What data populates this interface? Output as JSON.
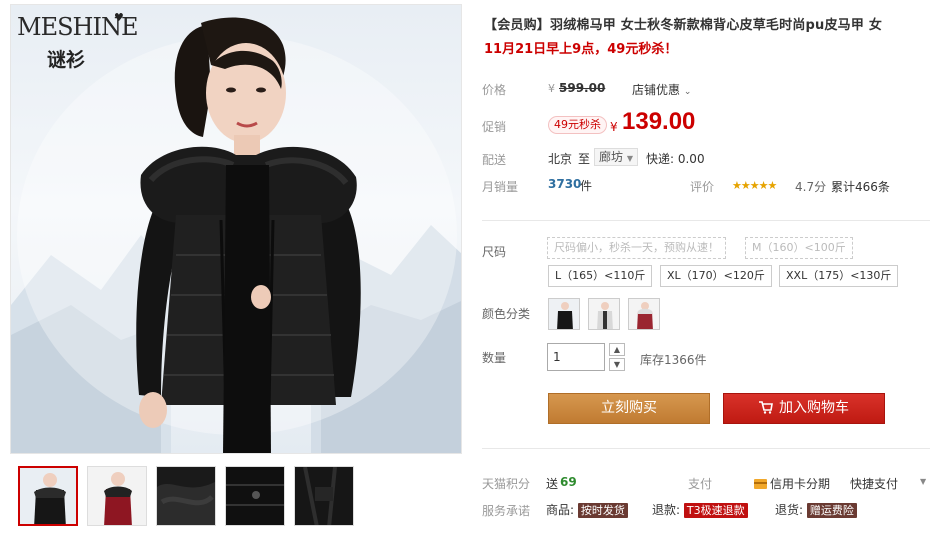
{
  "brand": {
    "name": "MESHINE",
    "name_cn": "谜衫"
  },
  "product": {
    "title": "【会员购】羽绒棉马甲 女士秋冬新款棉背心皮草毛时尚pu皮马甲 女",
    "subtitle": "11月21日早上9点，49元秒杀！"
  },
  "pricing": {
    "price_label": "价格",
    "original_currency": "¥",
    "original_price": "599.00",
    "store_discount": "店铺优惠",
    "promo_label": "促销",
    "promo_tag": "49元秒杀",
    "promo_currency": "¥",
    "promo_price": "139.00",
    "shipping_label": "配送",
    "ship_from": "北京",
    "ship_to_word": "至",
    "ship_dest": "廊坊",
    "express": "快递: 0.00",
    "sales_label": "月销量",
    "sales_count": "3730",
    "sales_unit": "件",
    "rating_label": "评价",
    "rating_stars": 5,
    "rating_score": "4.7分",
    "review_count": "累计466条"
  },
  "options": {
    "size_label": "尺码",
    "sizes": [
      {
        "label": "尺码偏小，秒杀一天，预购从速！",
        "disabled": true
      },
      {
        "label": "M（160）<100斤",
        "disabled": true
      },
      {
        "label": "L（165）<110斤",
        "disabled": false
      },
      {
        "label": "XL（170）<120斤",
        "disabled": false
      },
      {
        "label": "XXL（175）<130斤",
        "disabled": false
      }
    ],
    "color_label": "颜色分类",
    "quantity_label": "数量",
    "quantity_value": "1",
    "stock": "库存1366件"
  },
  "actions": {
    "buy_now": "立刻购买",
    "add_to_cart": "加入购物车"
  },
  "services": {
    "points_label": "天猫积分",
    "points_prefix": "送",
    "points_value": "69",
    "pay_label": "支付",
    "credit_card": "信用卡分期",
    "quick_pay": "快捷支付",
    "promise_label": "服务承诺",
    "promise_goods": "商品:",
    "tag_on_time": "按时发货",
    "promise_refund": "退款:",
    "tag_fast_refund": "T3极速退款",
    "promise_return": "退货:",
    "tag_return_insurance": "赠运费险"
  },
  "colors": {
    "accent_red": "#cc0000",
    "buy_orange": "#c98a43",
    "cart_red": "#cf2a1f"
  },
  "icons": {
    "dropdown": "chevron-down-icon",
    "cart": "cart-icon",
    "pay": "credit-card-icon"
  }
}
